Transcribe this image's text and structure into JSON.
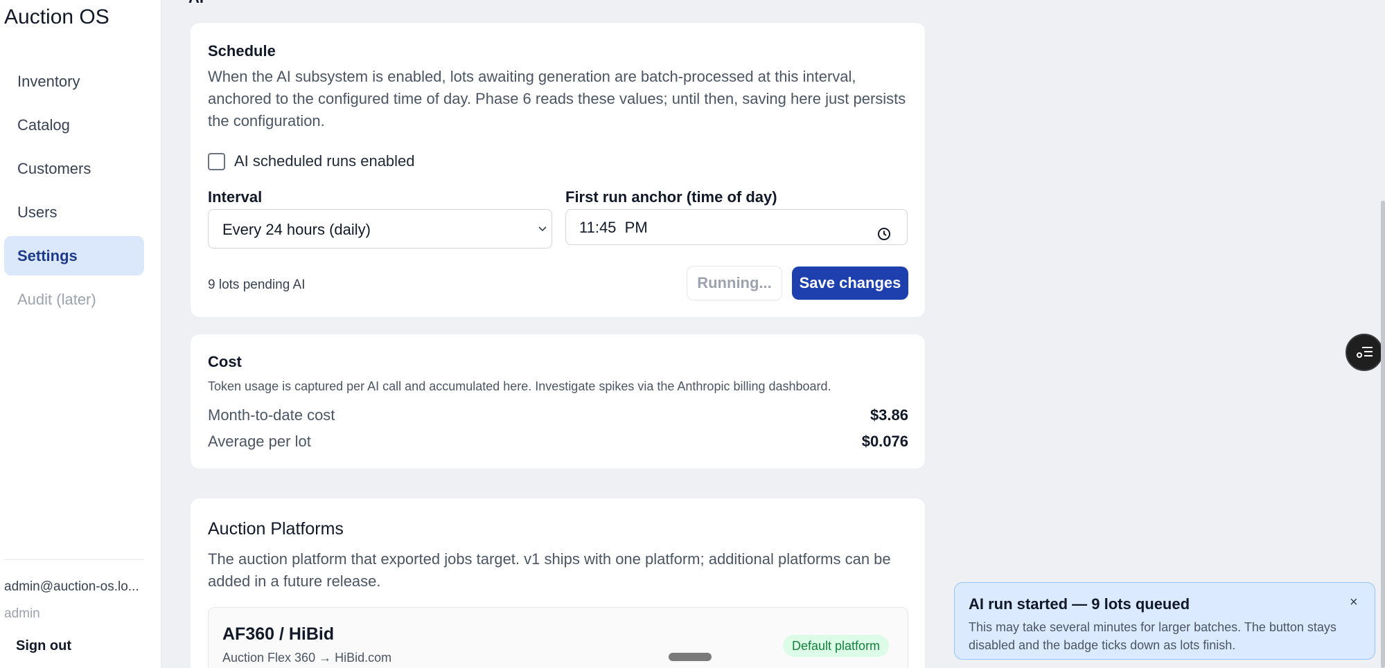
{
  "app": {
    "title": "Auction OS"
  },
  "sidebar": {
    "items": [
      {
        "label": "Inventory"
      },
      {
        "label": "Catalog"
      },
      {
        "label": "Customers"
      },
      {
        "label": "Users"
      },
      {
        "label": "Settings"
      },
      {
        "label": "Audit (later)"
      }
    ],
    "active": "Settings",
    "user": {
      "email": "admin@auction-os.lo...",
      "role": "admin"
    },
    "signout_label": "Sign out"
  },
  "section_heading": "AI",
  "schedule": {
    "title": "Schedule",
    "description": "When the AI subsystem is enabled, lots awaiting generation are batch-processed at this interval, anchored to the configured time of day. Phase 6 reads these values; until then, saving here just persists the configuration.",
    "checkbox_label": "AI scheduled runs enabled",
    "checkbox_checked": false,
    "interval_label": "Interval",
    "interval_value": "Every 24 hours (daily)",
    "anchor_label": "First run anchor (time of day)",
    "anchor_value": "11:45  PM",
    "pending_text": "9 lots pending AI",
    "running_label": "Running...",
    "save_label": "Save changes"
  },
  "cost": {
    "title": "Cost",
    "description": "Token usage is captured per AI call and accumulated here. Investigate spikes via the Anthropic billing dashboard.",
    "month_label": "Month-to-date cost",
    "month_value": "$3.86",
    "avg_label": "Average per lot",
    "avg_value": "$0.076"
  },
  "platforms": {
    "title": "Auction Platforms",
    "description": "The auction platform that exported jobs target. v1 ships with one platform; additional platforms can be added in a future release.",
    "items": [
      {
        "name": "AF360 / HiBid",
        "subtitle": "Auction Flex 360 → HiBid.com",
        "badge": "Default platform"
      }
    ]
  },
  "toast": {
    "title": "AI run started — 9 lots queued",
    "body": "This may take several minutes for larger batches. The button stays disabled and the badge ticks down as lots finish.",
    "close": "×"
  },
  "colors": {
    "accent": "#1e40af",
    "active_nav_bg": "#dbe7fb",
    "badge_bg": "#dcfce7",
    "toast_bg": "#dbeafe"
  }
}
